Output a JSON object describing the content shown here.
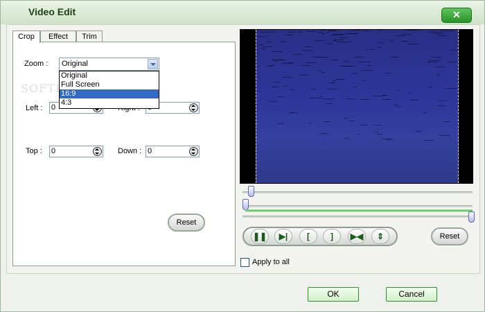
{
  "window": {
    "title": "Video Edit",
    "close_icon": "close-icon"
  },
  "tabs": [
    {
      "label": "Crop",
      "active": true
    },
    {
      "label": "Effect",
      "active": false
    },
    {
      "label": "Trim",
      "active": false
    }
  ],
  "crop": {
    "zoom_label": "Zoom :",
    "zoom_value": "Original",
    "zoom_options": [
      "Original",
      "Full Screen",
      "16:9",
      "4:3"
    ],
    "zoom_selected_option": "16:9",
    "left_label": "Left :",
    "left_value": "0",
    "right_label": "Right :",
    "right_value": "0",
    "top_label": "Top :",
    "top_value": "0",
    "down_label": "Down :",
    "down_value": "0",
    "reset_label": "Reset"
  },
  "watermark": "SOFTPEDIA",
  "player": {
    "controls": [
      {
        "name": "pause",
        "glyph": "❚❚"
      },
      {
        "name": "step-frame",
        "glyph": "▶|"
      },
      {
        "name": "mark-in",
        "glyph": "["
      },
      {
        "name": "mark-out",
        "glyph": "]"
      },
      {
        "name": "jump",
        "glyph": "▶◀"
      },
      {
        "name": "crop-fit",
        "glyph": "⇕"
      }
    ],
    "reset_label": "Reset",
    "apply_all_label": "Apply to all",
    "apply_all_checked": false
  },
  "footer": {
    "ok_label": "OK",
    "cancel_label": "Cancel"
  },
  "colors": {
    "accent": "#2f8f2f",
    "selection": "#316ac5",
    "video": "#2d3598"
  }
}
